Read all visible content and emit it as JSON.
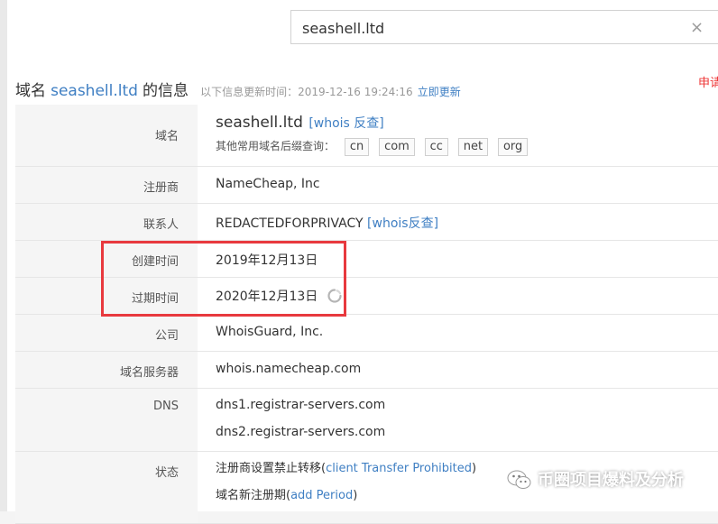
{
  "search": {
    "value": "seashell.ltd",
    "clear_glyph": "×"
  },
  "heading": {
    "prefix": "域名",
    "domain": "seashell.ltd",
    "suffix": "的信息",
    "update_label": "以下信息更新时间：",
    "update_time": "2019-12-16 19:24:16",
    "refresh_link": "立即更新"
  },
  "apply_text": "申请",
  "rows": {
    "domain": {
      "label": "域名",
      "value": "seashell.ltd",
      "link": "[whois 反查]",
      "suffix_label": "其他常用域名后缀查询：",
      "suffixes": [
        "cn",
        "com",
        "cc",
        "net",
        "org"
      ]
    },
    "registrar": {
      "label": "注册商",
      "value": "NameCheap, Inc"
    },
    "contact": {
      "label": "联系人",
      "value": "REDACTEDFORPRIVACY",
      "link": "[whois反查]"
    },
    "created": {
      "label": "创建时间",
      "value": "2019年12月13日"
    },
    "expires": {
      "label": "过期时间",
      "value": "2020年12月13日"
    },
    "company": {
      "label": "公司",
      "value": "WhoisGuard, Inc."
    },
    "whois_server": {
      "label": "域名服务器",
      "value": "whois.namecheap.com"
    },
    "dns": {
      "label": "DNS",
      "values": [
        "dns1.registrar-servers.com",
        "dns2.registrar-servers.com"
      ]
    },
    "status": {
      "label": "状态",
      "items": [
        {
          "text": "注册商设置禁止转移(",
          "link": "client Transfer Prohibited",
          "close": ")"
        },
        {
          "text": "域名新注册期(",
          "link": "add Period",
          "close": ")"
        }
      ]
    }
  },
  "watermark": "币圈项目爆料及分析",
  "colors": {
    "link": "#3f7fc3",
    "highlight_box": "#e8393e",
    "label_bg": "#f5f5f5"
  }
}
